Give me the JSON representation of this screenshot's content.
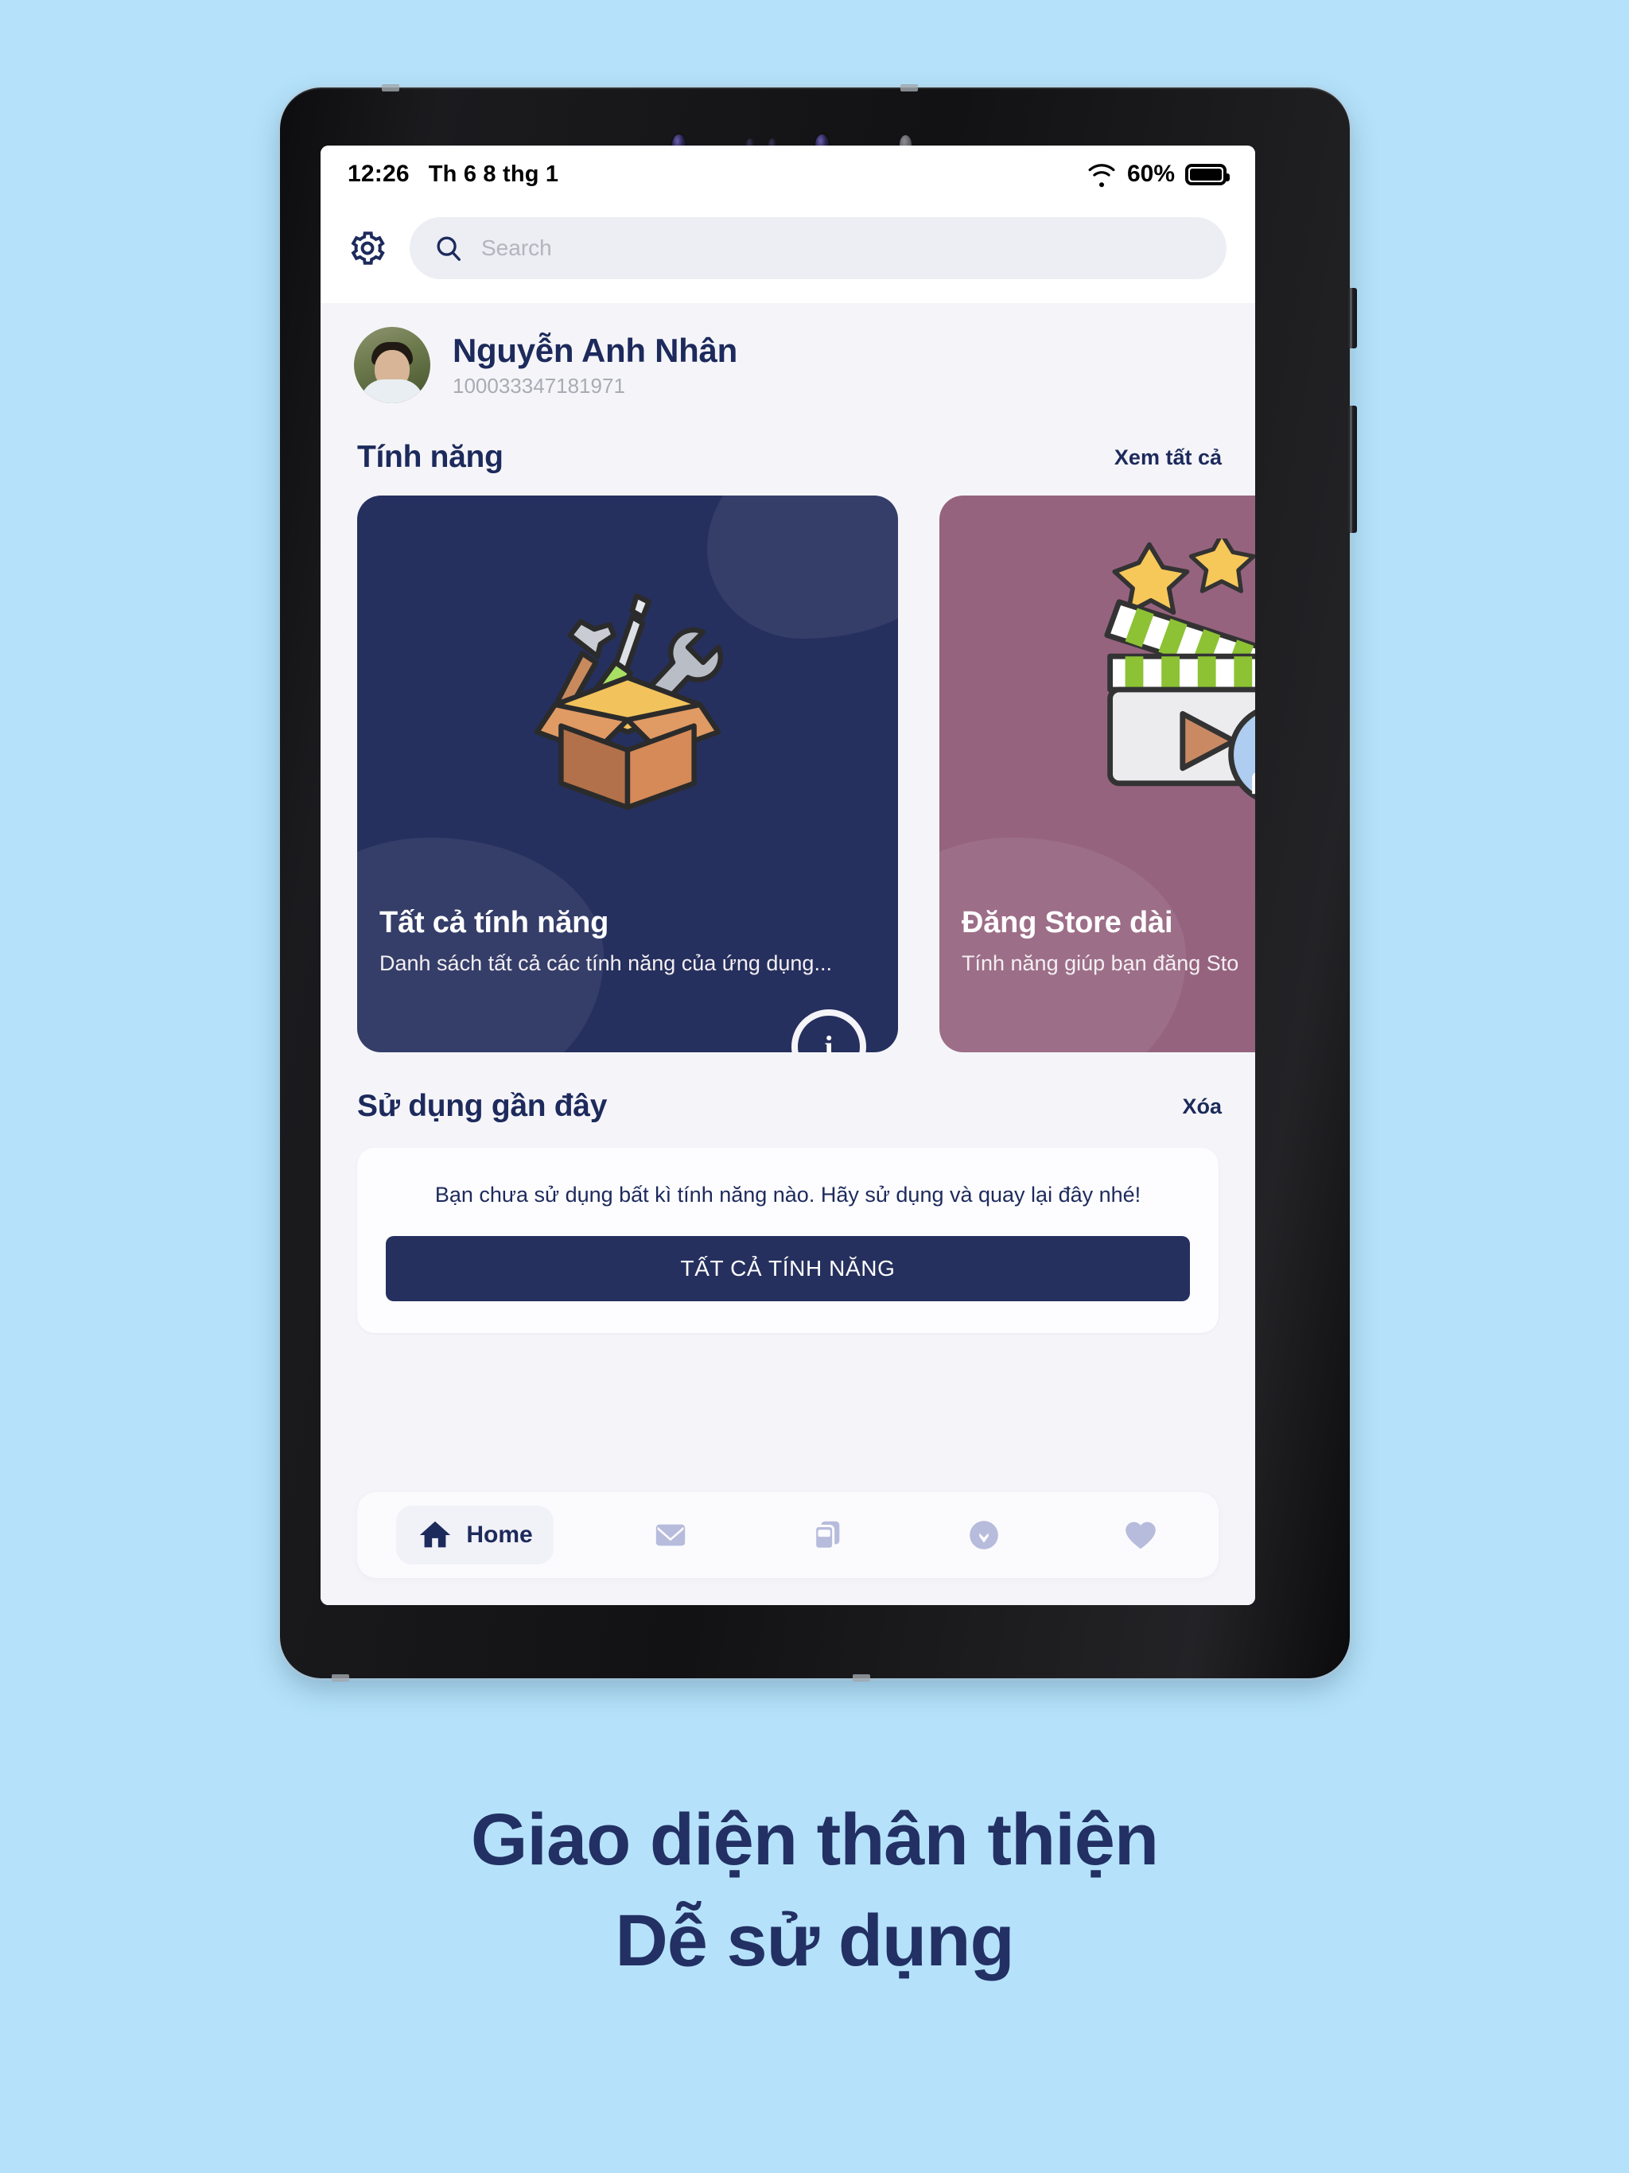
{
  "device": {
    "camera_icons": [
      "camera-lens",
      "sensor-dot",
      "sensor-dot",
      "camera-lens",
      "flash-dot"
    ],
    "buttons": [
      "power-button",
      "volume-button"
    ]
  },
  "statusbar": {
    "time": "12:26",
    "date": "Th 6 8 thg 1",
    "wifi_icon": "wifi-icon",
    "battery_percent": "60%",
    "battery_icon": "battery-full-icon"
  },
  "header": {
    "settings_icon": "gear-icon",
    "search": {
      "icon": "search-icon",
      "value": "",
      "placeholder": "Search"
    }
  },
  "profile": {
    "avatar": "user-avatar",
    "name": "Nguyễn Anh Nhân",
    "id": "100033347181971"
  },
  "features_section": {
    "title": "Tính năng",
    "action": "Xem tất cả",
    "cards": [
      {
        "title": "Tất cả tính năng",
        "subtitle": "Danh sách tất cả các tính năng của ứng dụng...",
        "art": "toolbox-icon",
        "bg": "#26305e",
        "badge": "i"
      },
      {
        "title": "Đăng Store dài",
        "subtitle": "Tính năng giúp bạn đăng Sto",
        "art": "clapperboard-upload-icon",
        "bg": "#96637f"
      }
    ]
  },
  "recent_section": {
    "title": "Sử dụng gần đây",
    "action": "Xóa",
    "empty_message": "Bạn chưa sử dụng bất kì tính năng nào. Hãy sử dụng và quay lại đây nhé!",
    "button_label": "TẤT CẢ TÍNH NĂNG"
  },
  "bottom_nav": [
    {
      "icon": "home-icon",
      "label": "Home",
      "active": true
    },
    {
      "icon": "mail-icon",
      "label": "",
      "active": false
    },
    {
      "icon": "copy-icon",
      "label": "",
      "active": false
    },
    {
      "icon": "download-icon",
      "label": "",
      "active": false
    },
    {
      "icon": "heart-icon",
      "label": "",
      "active": false
    }
  ],
  "caption": {
    "line1": "Giao diện thân thiện",
    "line2": "Dễ sử dụng"
  },
  "colors": {
    "page_background": "#b5e2fa",
    "brand_navy": "#26305e",
    "card_mauve": "#96637f",
    "app_background": "#f5f5f9",
    "muted_text": "#a9abb4"
  }
}
